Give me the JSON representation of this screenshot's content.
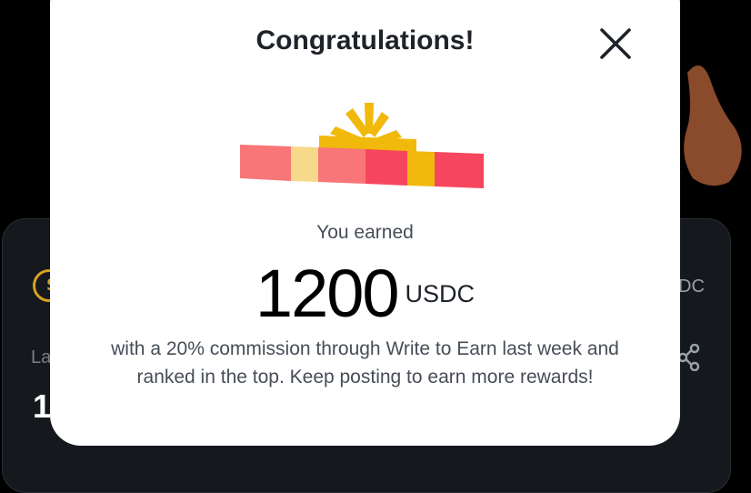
{
  "background": {
    "label_fragment": "La",
    "value_fragment": "1",
    "unit_fragment": "DC"
  },
  "modal": {
    "title": "Congratulations!",
    "close_icon": "close-icon",
    "gift_icon": "gift-icon",
    "earned_label": "You earned",
    "amount": "1200",
    "unit": "USDC",
    "message": "with a 20% commission through Write to Earn last week and ranked in the top. Keep posting to earn more rewards!"
  },
  "colors": {
    "accent_yellow": "#f0b90b",
    "gift_red": "#f6465d",
    "text_primary": "#1e2329",
    "text_secondary": "#474d57"
  }
}
